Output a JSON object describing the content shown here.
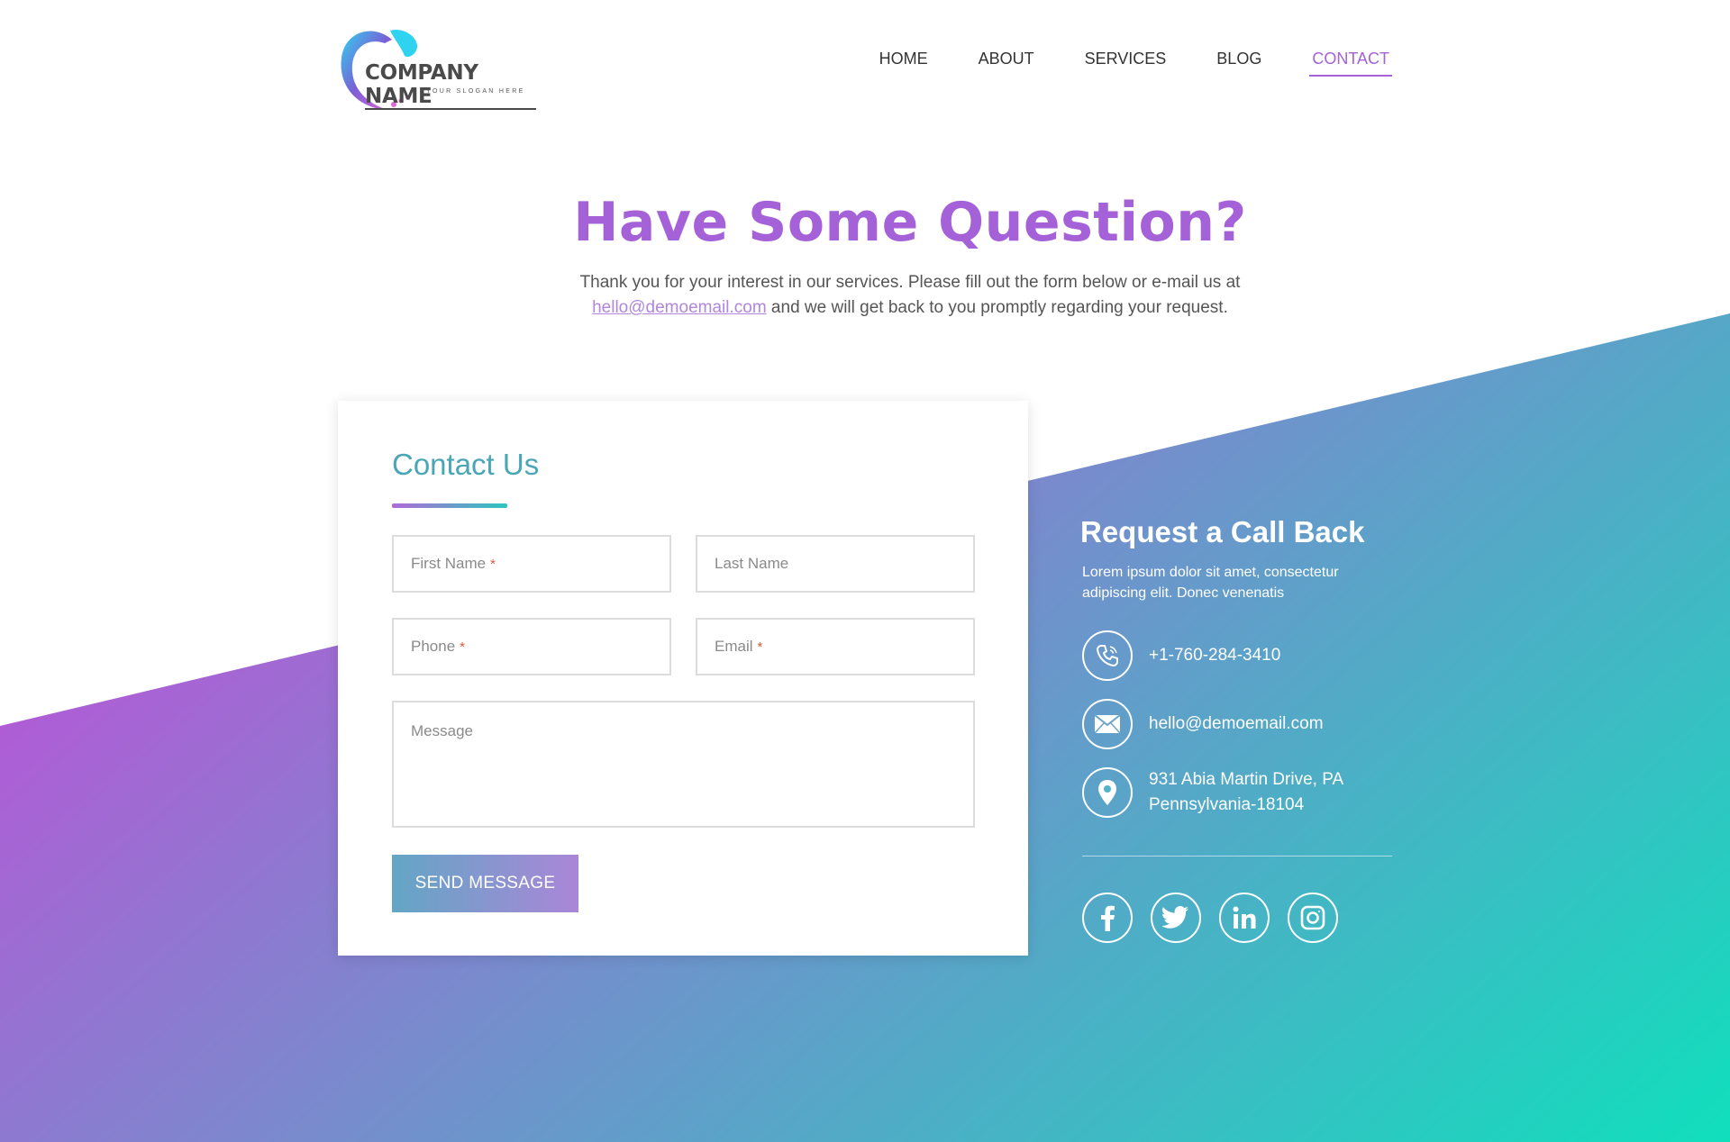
{
  "brand": {
    "name": "COMPANY NAME",
    "slogan": "YOUR SLOGAN HERE"
  },
  "nav": {
    "items": [
      {
        "label": "HOME"
      },
      {
        "label": "ABOUT"
      },
      {
        "label": "SERVICES"
      },
      {
        "label": "BLOG"
      },
      {
        "label": "CONTACT",
        "active": true
      }
    ]
  },
  "hero": {
    "title": "Have Some Question?",
    "text_line1": "Thank you for your interest in our services. Please fill out the form below or e-mail us at",
    "email": "hello@demoemail.com",
    "text_line2": " and we will get back to you promptly regarding your request."
  },
  "form": {
    "title": "Contact Us",
    "first_name": "First Name",
    "last_name": "Last Name",
    "phone": "Phone",
    "email": "Email",
    "message": "Message",
    "required_mark": "*",
    "submit_label": "SEND MESSAGE"
  },
  "callback": {
    "title": "Request a Call Back",
    "text": "Lorem ipsum dolor sit amet, consectetur adipiscing elit. Donec venenatis",
    "phone": "+1-760-284-3410",
    "email": "hello@demoemail.com",
    "address_line1": "931  Abia Martin Drive, PA",
    "address_line2": "Pennsylvania-18104"
  },
  "social": {
    "icons": [
      "facebook-icon",
      "twitter-icon",
      "linkedin-icon",
      "instagram-icon"
    ]
  },
  "colors": {
    "accent_purple": "#a461d8",
    "accent_teal": "#4aa6b6",
    "gradient_start": "#b35ad6",
    "gradient_mid": "#6b96cb",
    "gradient_end": "#10dfbc",
    "required": "#e2573b"
  }
}
